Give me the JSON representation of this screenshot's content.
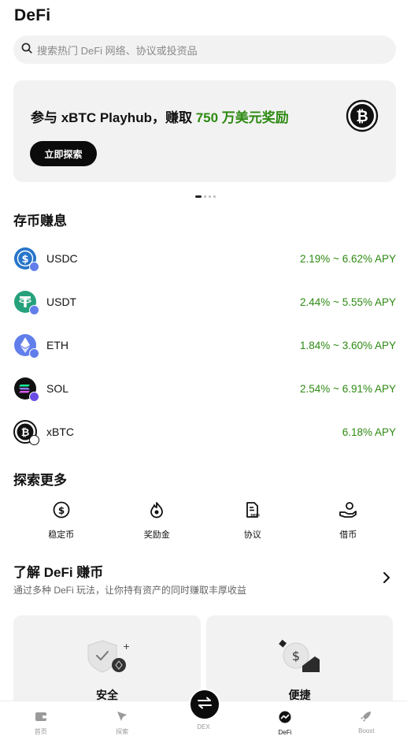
{
  "header": {
    "title": "DeFi"
  },
  "search": {
    "placeholder": "搜索热门 DeFi 网络、协议或投资品"
  },
  "banner": {
    "text_prefix": "参与 xBTC Playhub，赚取 ",
    "highlight": "750 万美元奖励",
    "button_label": "立即探索",
    "icon": "bitcoin-icon",
    "page_count": 4,
    "current_page": 1
  },
  "earn": {
    "heading": "存币赚息",
    "items": [
      {
        "name": "USDC",
        "apy": "2.19% ~ 6.62% APY",
        "icon": "usdc-icon",
        "color": "#2775ca"
      },
      {
        "name": "USDT",
        "apy": "2.44% ~ 5.55% APY",
        "icon": "usdt-icon",
        "color": "#26a17b"
      },
      {
        "name": "ETH",
        "apy": "1.84% ~ 3.60% APY",
        "icon": "eth-icon",
        "color": "#627eea"
      },
      {
        "name": "SOL",
        "apy": "2.54% ~ 6.91% APY",
        "icon": "sol-icon",
        "color": "#111111"
      },
      {
        "name": "xBTC",
        "apy": "6.18% APY",
        "icon": "xbtc-icon",
        "color": "#111111"
      }
    ]
  },
  "explore": {
    "heading": "探索更多",
    "items": [
      {
        "label": "稳定币",
        "icon": "stablecoin-icon"
      },
      {
        "label": "奖励金",
        "icon": "reward-icon"
      },
      {
        "label": "协议",
        "icon": "protocol-icon"
      },
      {
        "label": "借币",
        "icon": "borrow-icon"
      }
    ]
  },
  "learn": {
    "heading": "了解 DeFi 赚币",
    "subtitle": "通过多种 DeFi 玩法，让你持有资产的同时赚取丰厚收益",
    "cards": [
      {
        "label": "安全",
        "icon": "shield-icon"
      },
      {
        "label": "便捷",
        "icon": "coin-hand-icon"
      }
    ]
  },
  "tabbar": {
    "items": [
      {
        "label": "首页",
        "icon": "wallet-icon"
      },
      {
        "label": "探索",
        "icon": "compass-icon"
      },
      {
        "label": "DEX",
        "icon": "swap-icon"
      },
      {
        "label": "DeFi",
        "icon": "defi-icon",
        "active": true
      },
      {
        "label": "Boost",
        "icon": "rocket-icon"
      }
    ]
  },
  "colors": {
    "accent_green": "#2d8a12",
    "dark": "#0b0b0b",
    "surface": "#f2f2f2"
  }
}
